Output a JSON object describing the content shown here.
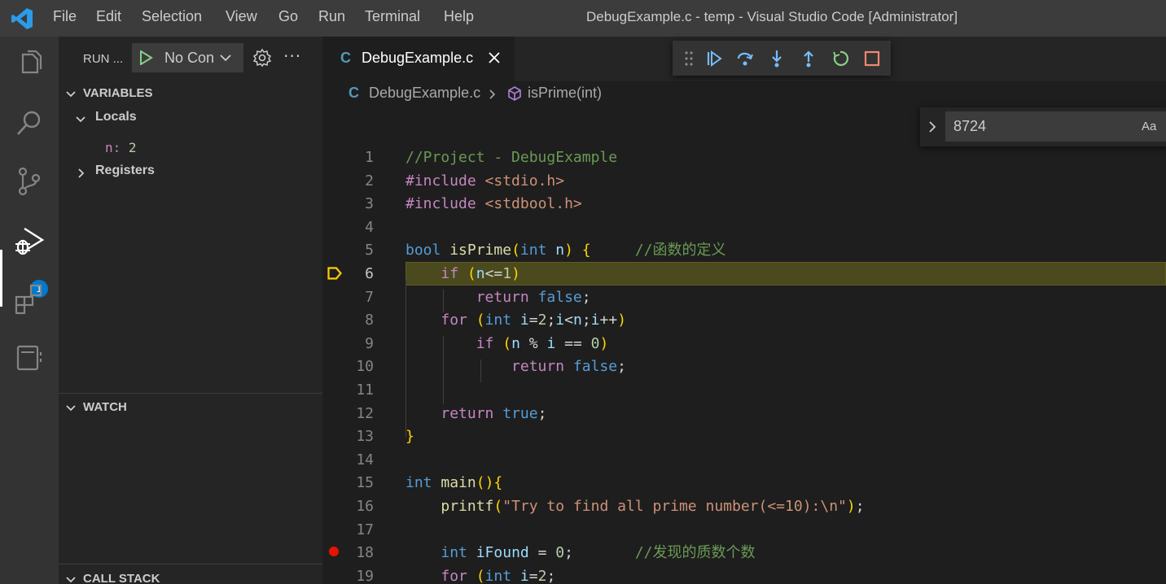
{
  "window": {
    "title": "DebugExample.c - temp - Visual Studio Code [Administrator]"
  },
  "menu": [
    "File",
    "Edit",
    "Selection",
    "View",
    "Go",
    "Run",
    "Terminal",
    "Help"
  ],
  "activity_bar": {
    "items": [
      "explorer-icon",
      "search-icon",
      "source-control-icon",
      "run-debug-icon",
      "extensions-icon",
      "notebook-icon"
    ],
    "active": "run-debug-icon",
    "debug_badge": "1"
  },
  "sidebar": {
    "run_label": "RUN ...",
    "config_name": "No Configurations",
    "variables": {
      "title": "VARIABLES",
      "locals_label": "Locals",
      "local_var_name": "n:",
      "local_var_value": "2",
      "registers_label": "Registers"
    },
    "watch_title": "WATCH",
    "call_stack_title": "CALL STACK"
  },
  "editor": {
    "tab_icon": "C",
    "tab_label": "DebugExample.c",
    "breadcrumb": {
      "file": "DebugExample.c",
      "symbol": "isPrime(int)"
    },
    "find": {
      "query": "8724",
      "match_case_label": "Aa"
    },
    "current_line": 6,
    "breakpoint_line": 18,
    "line_numbers": [
      "1",
      "2",
      "3",
      "4",
      "5",
      "6",
      "7",
      "8",
      "9",
      "10",
      "11",
      "12",
      "13",
      "14",
      "15",
      "16",
      "17",
      "18",
      "19"
    ],
    "code_lines": [
      "//Project - DebugExample",
      "#include <stdio.h>",
      "#include <stdbool.h>",
      "",
      "bool isPrime(int n) {     //函数的定义",
      "    if (n<=1)",
      "        return false;",
      "    for (int i=2;i<n;i++)",
      "        if (n % i == 0)",
      "            return false;",
      "",
      "    return true;",
      "}",
      "",
      "int main(){",
      "    printf(\"Try to find all prime number(<=10):\\n\");",
      "",
      "    int iFound = 0;       //发现的质数个数",
      "    for (int i=2;"
    ]
  },
  "colors": {
    "accent": "#007acc",
    "current_line_bg": "#4b4a1e",
    "breakpoint": "#e51400",
    "debug_arrow": "#ffcc00"
  }
}
